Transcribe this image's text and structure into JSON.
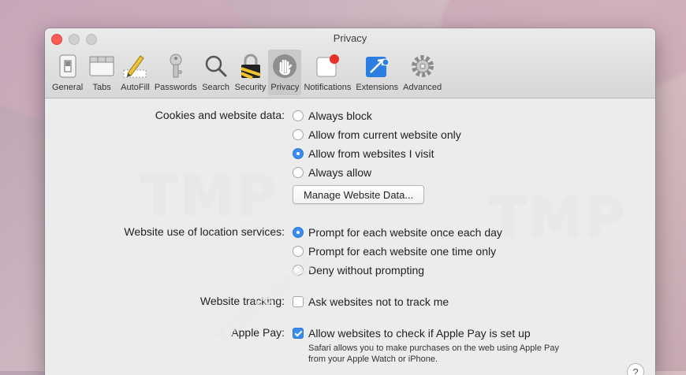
{
  "window": {
    "title": "Privacy"
  },
  "toolbar": {
    "items": [
      {
        "label": "General",
        "icon": "general-switch-icon"
      },
      {
        "label": "Tabs",
        "icon": "tabs-icon"
      },
      {
        "label": "AutoFill",
        "icon": "pencil-icon"
      },
      {
        "label": "Passwords",
        "icon": "key-icon"
      },
      {
        "label": "Search",
        "icon": "search-icon"
      },
      {
        "label": "Security",
        "icon": "lock-icon"
      },
      {
        "label": "Privacy",
        "icon": "hand-icon",
        "active": true
      },
      {
        "label": "Notifications",
        "icon": "notifications-icon"
      },
      {
        "label": "Extensions",
        "icon": "extensions-icon"
      },
      {
        "label": "Advanced",
        "icon": "gear-icon"
      }
    ]
  },
  "cookies": {
    "label": "Cookies and website data:",
    "options": [
      "Always block",
      "Allow from current website only",
      "Allow from websites I visit",
      "Always allow"
    ],
    "selected": "Allow from websites I visit",
    "manage_button": "Manage Website Data..."
  },
  "location": {
    "label": "Website use of location services:",
    "options": [
      "Prompt for each website once each day",
      "Prompt for each website one time only",
      "Deny without prompting"
    ],
    "selected": "Prompt for each website once each day"
  },
  "tracking": {
    "label": "Website tracking:",
    "checkbox": "Ask websites not to track me",
    "checked": false
  },
  "apple_pay": {
    "label": "Apple Pay:",
    "checkbox": "Allow websites to check if Apple Pay is set up",
    "checked": true,
    "note": "Safari allows you to make purchases on the web using Apple Pay from your Apple Watch or iPhone."
  },
  "help_button": "?",
  "watermark": {
    "left": "TMP",
    "right": "TMP",
    "diagonal": "TAIMIENPHI"
  },
  "colors": {
    "accent": "#3b8cf0",
    "close": "#fc5f57"
  }
}
